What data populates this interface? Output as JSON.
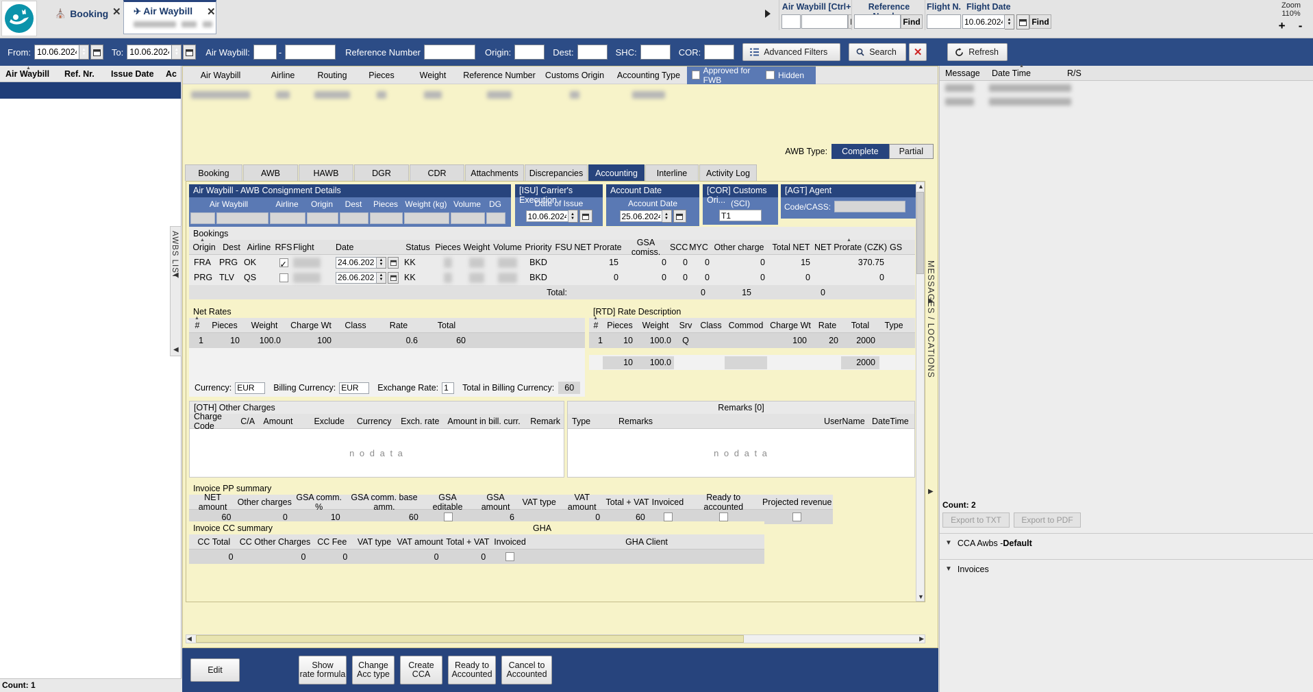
{
  "window": {
    "tabs": [
      {
        "label": "Booking",
        "icon": "home-icon",
        "active": false,
        "subtitle_redacted": true
      },
      {
        "label": "Air Waybill",
        "icon": "plane-icon",
        "active": true,
        "subtitle_redacted": true
      }
    ]
  },
  "quick_search": {
    "awb_label": "Air Waybill [Ctrl+F]",
    "awb_find": "Find",
    "ref_label": "Reference Number",
    "ref_find": "Find",
    "flight_no_label": "Flight N.",
    "flight_date_label": "Flight Date",
    "flight_date_value": "10.06.2024",
    "flight_find": "Find",
    "zoom_label": "Zoom",
    "zoom_value": "110%",
    "zoom_in": "+",
    "zoom_out": "-"
  },
  "filterbar": {
    "from_label": "From:",
    "from_value": "10.06.2024",
    "to_label": "To:",
    "to_value": "10.06.2024",
    "awb_label": "Air Waybill:",
    "awb_prefix": "",
    "awb_dash": "-",
    "awb_number": "",
    "ref_label": "Reference Number",
    "ref_value": "",
    "origin_label": "Origin:",
    "origin_value": "",
    "dest_label": "Dest:",
    "dest_value": "",
    "shc_label": "SHC:",
    "shc_value": "",
    "cor_label": "COR:",
    "cor_value": "",
    "advanced_filters": "Advanced Filters",
    "search": "Search",
    "clear": "✕",
    "refresh": "Refresh"
  },
  "left_grid": {
    "columns": [
      "Air Waybill",
      "Ref. Nr.",
      "Issue Date",
      "Ac"
    ],
    "rows": [
      {
        "redacted": true
      }
    ],
    "count_label": "Count: 1",
    "awbs_list_label": "AWBS LIST"
  },
  "awb_header": {
    "columns": [
      "Air Waybill",
      "Airline",
      "Routing",
      "Pieces",
      "Weight",
      "Reference Number",
      "Customs Origin",
      "Accounting Type"
    ],
    "row_redacted": true,
    "approved_fwb": "Approved for FWB",
    "hidden": "Hidden",
    "awb_type_label": "AWB Type:",
    "awb_type_complete": "Complete",
    "awb_type_partial": "Partial",
    "awb_type_selected": "Complete"
  },
  "tabs": [
    {
      "label": "Booking",
      "active": false
    },
    {
      "label": "AWB",
      "active": false
    },
    {
      "label": "HAWB",
      "active": false
    },
    {
      "label": "DGR",
      "active": false
    },
    {
      "label": "CDR",
      "active": false
    },
    {
      "label": "Attachments",
      "active": false
    },
    {
      "label": "Discrepancies",
      "active": false
    },
    {
      "label": "Accounting",
      "active": true
    },
    {
      "label": "Interline",
      "active": false
    },
    {
      "label": "Activity Log",
      "active": false
    }
  ],
  "consignment": {
    "title": "Air Waybill - AWB Consignment Details",
    "columns": [
      "Air Waybill",
      "Airline",
      "Origin",
      "Dest",
      "Pieces",
      "Weight (kg)",
      "Volume",
      "DG"
    ],
    "values_redacted": true
  },
  "carrier_execution": {
    "title": "[ISU] Carrier's Execution",
    "field_label": "Date of Issue",
    "date_value": "10.06.2024"
  },
  "account_date_panel": {
    "title": "Account Date",
    "field_label": "Account Date",
    "date_value": "25.06.2024"
  },
  "customs_origin": {
    "title": "[COR] Customs Ori...",
    "field_label": "(SCI)",
    "value": "T1"
  },
  "agent": {
    "title": "[AGT] Agent",
    "code_label": "Code/CASS:",
    "code_value_redacted": true
  },
  "bookings": {
    "section_label": "Bookings",
    "columns": [
      "Origin",
      "Dest",
      "Airline",
      "RFS",
      "Flight",
      "Date",
      "Status",
      "Pieces",
      "Weight",
      "Volume",
      "Priority",
      "FSU",
      "NET Prorate",
      "GSA comiss.",
      "SCC",
      "MYC",
      "Other charge",
      "Total NET",
      "NET Prorate (CZK)",
      "GS"
    ],
    "rows": [
      {
        "origin": "FRA",
        "dest": "PRG",
        "airline": "OK",
        "rfs_checked": true,
        "flight_redacted": true,
        "date": "24.06.2024",
        "status": "KK",
        "pieces_redacted": true,
        "weight_redacted": true,
        "volume_redacted": true,
        "priority": "BKD",
        "fsu": "",
        "net_prorate": "15",
        "gsa_comiss": "0",
        "scc": "0",
        "myc": "0",
        "other_charge": "0",
        "total_net": "15",
        "net_prorate_czk": "370.75"
      },
      {
        "origin": "PRG",
        "dest": "TLV",
        "airline": "QS",
        "rfs_checked": false,
        "flight_redacted": true,
        "date": "26.06.2024",
        "status": "KK",
        "pieces_redacted": true,
        "weight_redacted": true,
        "volume_redacted": true,
        "priority": "BKD",
        "fsu": "",
        "net_prorate": "0",
        "gsa_comiss": "0",
        "scc": "0",
        "myc": "0",
        "other_charge": "0",
        "total_net": "0",
        "net_prorate_czk": "0"
      }
    ],
    "total_label": "Total:",
    "total_other_charge": "0",
    "total_net": "15",
    "total_prorate_czk": "0"
  },
  "net_rates": {
    "section_label": "Net Rates",
    "columns": [
      "#",
      "Pieces",
      "Weight",
      "Charge Wt",
      "Class",
      "Rate",
      "Total"
    ],
    "rows": [
      {
        "num": "1",
        "pieces": "10",
        "weight": "100.0",
        "charge_wt": "100",
        "class": "",
        "rate": "0.6",
        "total": "60"
      }
    ]
  },
  "rate_description": {
    "section_label": "[RTD] Rate Description",
    "columns": [
      "#",
      "Pieces",
      "Weight",
      "Srv",
      "Class",
      "Commod",
      "Charge Wt",
      "Rate",
      "Total",
      "Type"
    ],
    "rows": [
      {
        "num": "1",
        "pieces": "10",
        "weight": "100.0",
        "srv": "Q",
        "class": "",
        "commod": "",
        "charge_wt": "100",
        "rate": "20",
        "total": "2000",
        "type": ""
      },
      {
        "num": "",
        "pieces": "10",
        "weight": "100.0",
        "srv": "",
        "class": "",
        "commod": "",
        "charge_wt": "",
        "rate": "",
        "total": "2000",
        "type": ""
      }
    ]
  },
  "currency_row": {
    "currency_label": "Currency:",
    "currency_value": "EUR",
    "billing_currency_label": "Billing Currency:",
    "billing_currency_value": "EUR",
    "exchange_rate_label": "Exchange Rate:",
    "exchange_rate_value": "1",
    "total_billing_label": "Total in Billing Currency:",
    "total_billing_value": "60"
  },
  "other_charges": {
    "title": "[OTH] Other Charges",
    "columns": [
      "Charge Code",
      "C/A",
      "Amount",
      "Exclude",
      "Currency",
      "Exch. rate",
      "Amount in bill. curr.",
      "Remark"
    ],
    "empty_text": "n o   d a t a"
  },
  "remarks": {
    "title": "Remarks [0]",
    "columns": [
      "Type",
      "Remarks",
      "UserName",
      "DateTime"
    ],
    "empty_text": "n o   d a t a"
  },
  "invoice_pp": {
    "section_label": "Invoice PP summary",
    "columns": [
      "NET amount",
      "Other charges",
      "GSA comm. %",
      "GSA comm. base amm.",
      "GSA editable",
      "GSA amount",
      "VAT type",
      "VAT amount",
      "Total + VAT",
      "Invoiced",
      "Ready to accounted",
      "Projected revenue"
    ],
    "values": {
      "net_amount": "60",
      "other_charges": "0",
      "gsa_comm_pct": "10",
      "gsa_comm_base": "60",
      "gsa_editable_checked": false,
      "gsa_amount": "6",
      "vat_type": "",
      "vat_amount": "0",
      "total_vat": "60",
      "invoiced_checked": false,
      "ready_checked": false,
      "projected_checked": false
    }
  },
  "invoice_cc": {
    "section_label": "Invoice CC summary",
    "columns": [
      "CC Total",
      "CC Other Charges",
      "CC Fee",
      "VAT type",
      "VAT amount",
      "Total + VAT",
      "Invoiced"
    ],
    "values": {
      "cc_total": "0",
      "cc_other_charges": "0",
      "cc_fee": "0",
      "vat_type": "",
      "vat_amount": "0",
      "total_vat": "0",
      "invoiced_checked": false
    }
  },
  "gha": {
    "section_label": "GHA",
    "column": "GHA Client"
  },
  "action_buttons": [
    {
      "label": "Edit",
      "lines": [
        "Edit"
      ]
    },
    {
      "label": "Show rate formula",
      "lines": [
        "Show",
        "rate formula"
      ]
    },
    {
      "label": "Change Acc type",
      "lines": [
        "Change",
        "Acc type"
      ]
    },
    {
      "label": "Create CCA",
      "lines": [
        "Create",
        "CCA"
      ]
    },
    {
      "label": "Ready to Accounted",
      "lines": [
        "Ready to",
        "Accounted"
      ]
    },
    {
      "label": "Cancel to Accounted",
      "lines": [
        "Cancel to",
        "Accounted"
      ]
    }
  ],
  "right_panel": {
    "columns": [
      "Message",
      "Date Time",
      "R/S"
    ],
    "rows_redacted": 2,
    "messages_locations_label": "MESSAGES / LOCATIONS",
    "count_label": "Count: 2",
    "export_txt": "Export to TXT",
    "export_pdf": "Export to PDF",
    "accordions": [
      {
        "label": "CCA Awbs - Default",
        "bold_part": "Default",
        "prefix": "CCA Awbs - "
      },
      {
        "label": "Invoices",
        "bold_part": "",
        "prefix": "Invoices"
      }
    ]
  },
  "colors": {
    "brand_blue": "#27447d",
    "filter_blue": "#2c4c86",
    "panel_cream": "#f7f3c9",
    "sub_blue": "#5a79b4",
    "logo_teal": "#0b93ab"
  }
}
